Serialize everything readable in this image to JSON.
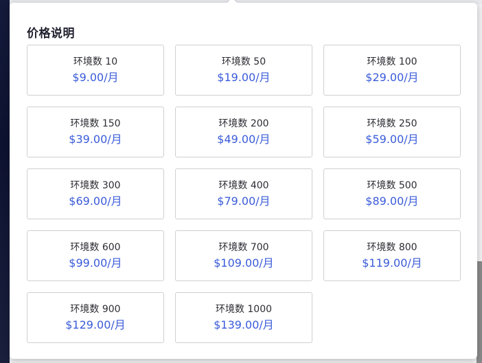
{
  "panel": {
    "title": "价格说明"
  },
  "plans": [
    {
      "label": "环境数 10",
      "price": "$9.00/月"
    },
    {
      "label": "环境数 50",
      "price": "$19.00/月"
    },
    {
      "label": "环境数 100",
      "price": "$29.00/月"
    },
    {
      "label": "环境数 150",
      "price": "$39.00/月"
    },
    {
      "label": "环境数 200",
      "price": "$49.00/月"
    },
    {
      "label": "环境数 250",
      "price": "$59.00/月"
    },
    {
      "label": "环境数 300",
      "price": "$69.00/月"
    },
    {
      "label": "环境数 400",
      "price": "$79.00/月"
    },
    {
      "label": "环境数 500",
      "price": "$89.00/月"
    },
    {
      "label": "环境数 600",
      "price": "$99.00/月"
    },
    {
      "label": "环境数 700",
      "price": "$109.00/月"
    },
    {
      "label": "环境数 800",
      "price": "$119.00/月"
    },
    {
      "label": "环境数 900",
      "price": "$129.00/月"
    },
    {
      "label": "环境数 1000",
      "price": "$139.00/月"
    }
  ],
  "colors": {
    "price_accent": "#3a5bd9",
    "card_border": "#cfcfd4",
    "title_text": "#1f1f2e"
  }
}
